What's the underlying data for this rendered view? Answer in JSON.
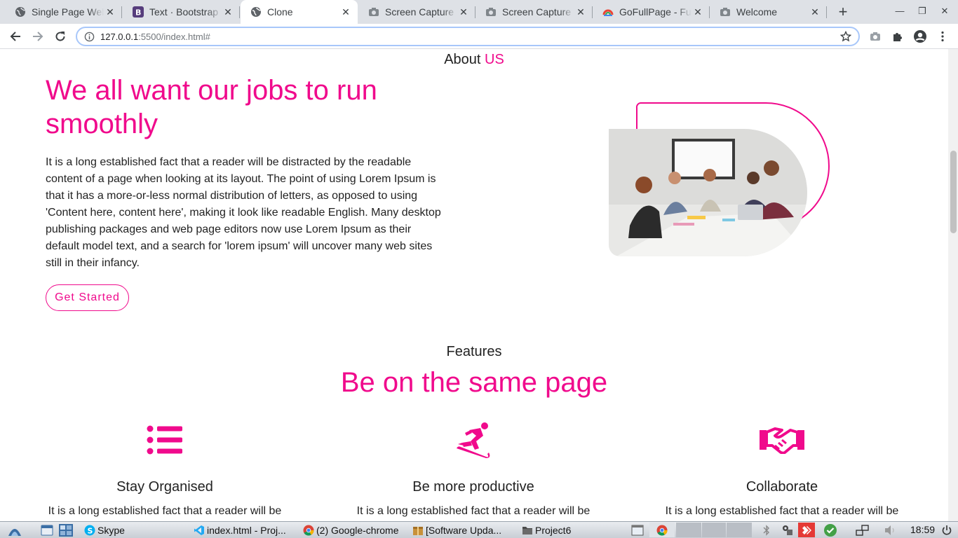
{
  "browser": {
    "tabs": [
      {
        "title": "Single Page Web",
        "icon": "globe-icon",
        "active": false
      },
      {
        "title": "Text · Bootstrap",
        "icon": "bootstrap-icon",
        "active": false
      },
      {
        "title": "Clone",
        "icon": "globe-icon",
        "active": true
      },
      {
        "title": "Screen Capture",
        "icon": "camera-icon",
        "active": false
      },
      {
        "title": "Screen Capture",
        "icon": "camera-icon",
        "active": false
      },
      {
        "title": "GoFullPage - Fu",
        "icon": "gofullpage-icon",
        "active": false
      },
      {
        "title": "Welcome",
        "icon": "camera-icon",
        "active": false
      }
    ],
    "url": {
      "host": "127.0.0.1",
      "rest": ":5500/index.html#"
    }
  },
  "about": {
    "heading_prefix": "About",
    "heading_highlight": "US",
    "title": "We all want our jobs to run smoothly",
    "text": "It is a long established fact that a reader will be distracted by the readable content of a page when looking at its layout. The point of using Lorem Ipsum is that it has a more-or-less normal distribution of letters, as opposed to using 'Content here, content here', making it look like readable English. Many desktop publishing packages and web page editors now use Lorem Ipsum as their default model text, and a search for 'lorem ipsum' will uncover many web sites still in their infancy.",
    "cta": "Get Started"
  },
  "features": {
    "heading": "Features",
    "title": "Be on the same page",
    "items": [
      {
        "icon": "list-icon",
        "title": "Stay Organised",
        "text": "It is a long established fact that a reader will be"
      },
      {
        "icon": "snowboarder-icon",
        "title": "Be more productive",
        "text": "It is a long established fact that a reader will be"
      },
      {
        "icon": "handshake-icon",
        "title": "Collaborate",
        "text": "It is a long established fact that a reader will be"
      }
    ]
  },
  "taskbar": {
    "items": [
      {
        "label": "Skype",
        "icon": "skype-icon"
      },
      {
        "label": "index.html - Proj...",
        "icon": "vscode-icon"
      },
      {
        "label": "(2) Google-chrome",
        "icon": "chrome-icon"
      },
      {
        "label": "[Software Upda...",
        "icon": "package-icon"
      },
      {
        "label": "Project6",
        "icon": "folder-icon"
      }
    ],
    "clock": "18:59"
  },
  "colors": {
    "accent": "#f00a8c"
  }
}
